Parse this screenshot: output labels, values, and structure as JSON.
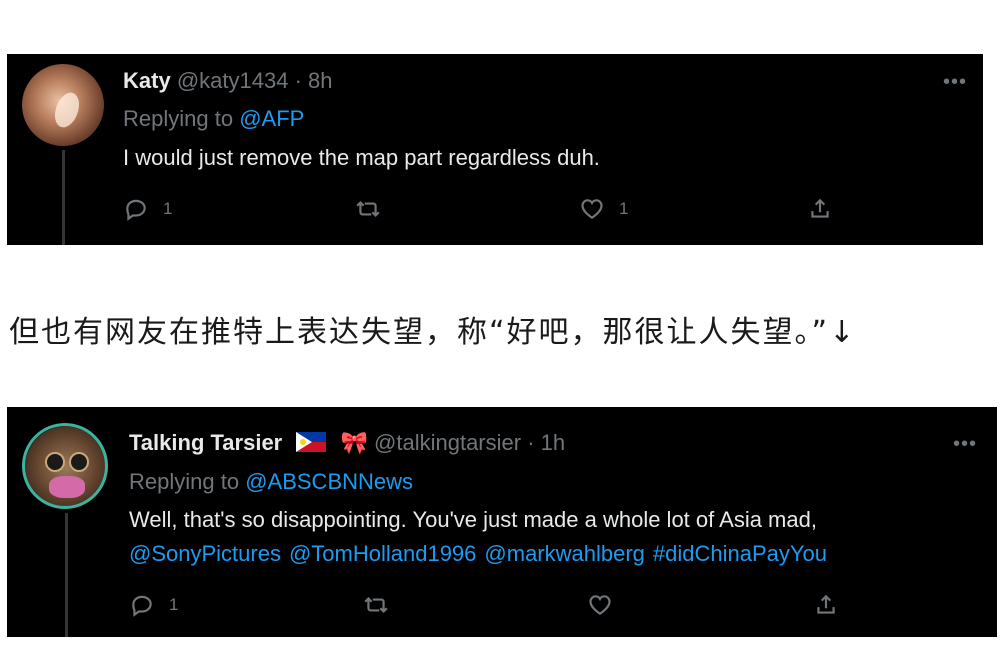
{
  "tweets": [
    {
      "name": "Katy",
      "handle": "@katy1434",
      "separator": "·",
      "time": "8h",
      "replying_prefix": "Replying to",
      "replying_to": "@AFP",
      "body_line1": "I would just remove the map part regardless duh.",
      "reply_count": "1",
      "retweet_count": "",
      "like_count": "1",
      "more_icon": "more-horizontal-icon"
    },
    {
      "name": "Talking Tarsier",
      "handle": "@talkingtarsier",
      "separator": "·",
      "time": "1h",
      "replying_prefix": "Replying to",
      "replying_to": "@ABSCBNNews",
      "body_line1": "Well, that's so disappointing. You've just made a whole lot of Asia mad,",
      "body_mentions": [
        "@SonyPictures",
        "@TomHolland1996",
        "@markwahlberg",
        "#didChinaPayYou"
      ],
      "reply_count": "1",
      "retweet_count": "",
      "like_count": "",
      "name_icons": [
        "philippines-flag-icon",
        "ribbon-icon"
      ],
      "more_icon": "more-horizontal-icon"
    }
  ],
  "between_text": "但也有网友在推特上表达失望，称“好吧，那很让人失望。”↓",
  "colors": {
    "card_background": "#000000",
    "name_text": "#e7e9ea",
    "secondary_text": "#71767b",
    "link": "#1d9bf0",
    "page_background": "#ffffff",
    "article_text": "#1a1a1a"
  },
  "icons": {
    "reply": "reply-icon",
    "retweet": "retweet-icon",
    "like": "heart-icon",
    "share": "share-icon"
  }
}
